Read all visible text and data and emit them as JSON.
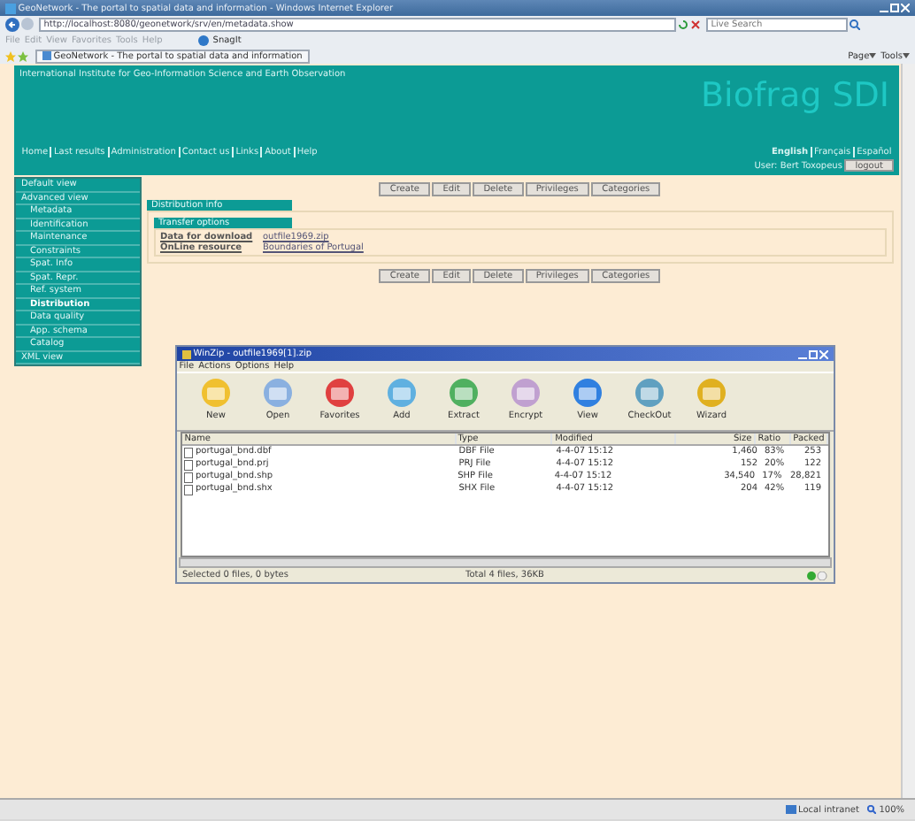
{
  "browser": {
    "title": "GeoNetwork - The portal to spatial data and information - Windows Internet Explorer",
    "address": "http://localhost:8080/geonetwork/srv/en/metadata.show",
    "search_placeholder": "Live Search",
    "menu": [
      "File",
      "Edit",
      "View",
      "Favorites",
      "Tools",
      "Help"
    ],
    "snagit": "SnagIt",
    "tab": "GeoNetwork - The portal to spatial data and information",
    "tools": [
      "Page",
      "Tools"
    ],
    "status": {
      "zone": "Local intranet",
      "zoom": "100%"
    }
  },
  "header": {
    "institute": "International Institute for Geo-Information Science and Earth Observation",
    "title": "Biofrag SDI",
    "nav": [
      "Home",
      "Last results",
      "Administration",
      "Contact us",
      "Links",
      "About",
      "Help"
    ],
    "languages": [
      {
        "label": "English",
        "selected": true
      },
      {
        "label": "Français",
        "selected": false
      },
      {
        "label": "Español",
        "selected": false
      }
    ],
    "user": "User: Bert Toxopeus",
    "logout": "logout"
  },
  "sidebar": [
    {
      "label": "Default view",
      "selected": false
    },
    {
      "label": "Advanced view",
      "selected": false,
      "children": [
        {
          "label": "Metadata",
          "selected": false
        },
        {
          "label": "Identification",
          "selected": false
        },
        {
          "label": "Maintenance",
          "selected": false
        },
        {
          "label": "Constraints",
          "selected": false
        },
        {
          "label": "Spat. Info",
          "selected": false
        },
        {
          "label": "Spat. Repr.",
          "selected": false
        },
        {
          "label": "Ref. system",
          "selected": false
        },
        {
          "label": "Distribution",
          "selected": true
        },
        {
          "label": "Data quality",
          "selected": false
        },
        {
          "label": "App. schema",
          "selected": false
        },
        {
          "label": "Catalog",
          "selected": false
        }
      ]
    },
    {
      "label": "XML view",
      "selected": false
    }
  ],
  "actions_top": [
    "Create",
    "Edit",
    "Delete",
    "Privileges",
    "Categories"
  ],
  "distribution": {
    "title": "Distribution info",
    "subtitle": "Transfer options",
    "fields": [
      {
        "label": "Data for download",
        "value": "outfile1969.zip"
      },
      {
        "label": "OnLine resource",
        "value": "Boundaries of Portugal"
      }
    ]
  },
  "actions_bottom": [
    "Create",
    "Edit",
    "Delete",
    "Privileges",
    "Categories"
  ],
  "winzip": {
    "title": "WinZip - outfile1969[1].zip",
    "menu": [
      "File",
      "Actions",
      "Options",
      "Help"
    ],
    "toolbar": [
      "New",
      "Open",
      "Favorites",
      "Add",
      "Extract",
      "Encrypt",
      "View",
      "CheckOut",
      "Wizard"
    ],
    "columns": [
      "Name",
      "Type",
      "Modified",
      "Size",
      "Ratio",
      "Packed"
    ],
    "rows": [
      [
        "portugal_bnd.dbf",
        "DBF File",
        "4-4-07 15:12",
        "1,460",
        "83%",
        "253"
      ],
      [
        "portugal_bnd.prj",
        "PRJ File",
        "4-4-07 15:12",
        "152",
        "20%",
        "122"
      ],
      [
        "portugal_bnd.shp",
        "SHP File",
        "4-4-07 15:12",
        "34,540",
        "17%",
        "28,821"
      ],
      [
        "portugal_bnd.shx",
        "SHX File",
        "4-4-07 15:12",
        "204",
        "42%",
        "119"
      ]
    ],
    "status_left": "Selected 0 files, 0 bytes",
    "status_right": "Total 4 files, 36KB"
  }
}
